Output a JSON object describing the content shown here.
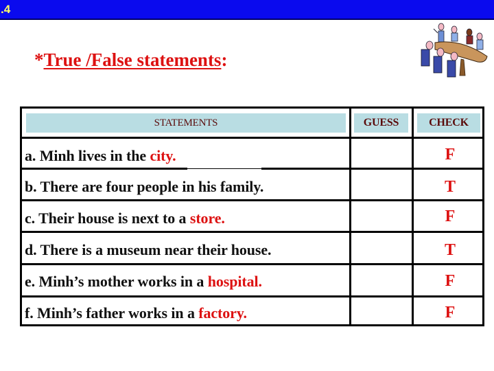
{
  "top_bar": {
    "slide_number": ".4",
    "color": "#0a0aee"
  },
  "title": {
    "prefix": "*",
    "text": "True /False statements",
    "suffix": ":",
    "color": "#dd1111"
  },
  "clipart": {
    "icon": "meeting-table-clipart"
  },
  "table": {
    "headers": {
      "statements": "STATEMENTS",
      "guess": "GUESS",
      "check": "CHECK"
    },
    "rows": [
      {
        "statement": "a. Minh lives in the ",
        "answer_word": "city.",
        "guess": "",
        "check": "F"
      },
      {
        "statement": "b. There are four people in his family.",
        "answer_word": "",
        "guess": "",
        "check": "T"
      },
      {
        "statement": "c. Their house is next to a ",
        "answer_word": "store.",
        "guess": "",
        "check": "F"
      },
      {
        "statement": "d. There is a museum near their house.",
        "answer_word": "",
        "guess": "",
        "check": "T"
      },
      {
        "statement": "e. Minh’s mother works in a ",
        "answer_word": "hospital.",
        "guess": "",
        "check": "F"
      },
      {
        "statement": "f. Minh’s father works in a ",
        "answer_word": "factory.",
        "guess": "",
        "check": "F"
      }
    ]
  },
  "colors": {
    "answer": "#dd1111",
    "header_fill": "#b9dde3",
    "header_text": "#5a0a0a"
  }
}
